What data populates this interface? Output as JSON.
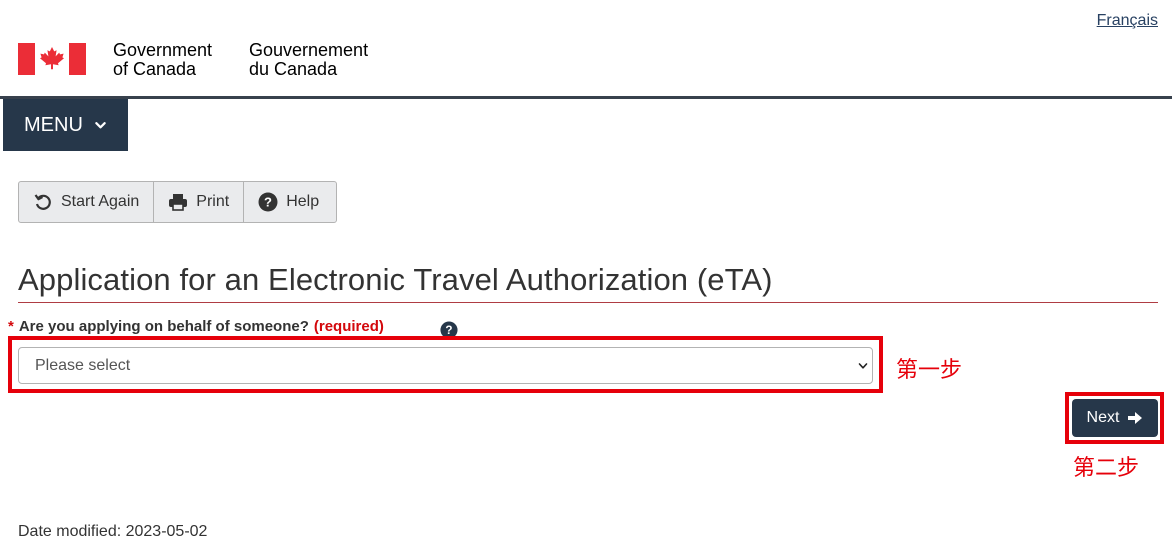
{
  "header": {
    "language_link": "Français",
    "gov_en_line1": "Government",
    "gov_en_line2": "of Canada",
    "gov_fr_line1": "Gouvernement",
    "gov_fr_line2": "du Canada",
    "flag_icon": "canada-flag-icon"
  },
  "menu": {
    "label": "MENU",
    "icon": "chevron-down-icon"
  },
  "toolbar": {
    "start_again": "Start Again",
    "print": "Print",
    "help": "Help"
  },
  "page": {
    "title": "Application for an Electronic Travel Authorization (eTA)",
    "question_star": "*",
    "question": "Are you applying on behalf of someone?",
    "required": "(required)",
    "select_value": "Please select",
    "next": "Next",
    "date_modified": "Date modified: 2023-05-02"
  },
  "annotations": {
    "step1": "第一步",
    "step2": "第二步",
    "highlight_color": "#e6000a"
  },
  "colors": {
    "brand_dark": "#26374a",
    "flag_red": "#eb2d37",
    "title_rule": "#af3c43"
  }
}
